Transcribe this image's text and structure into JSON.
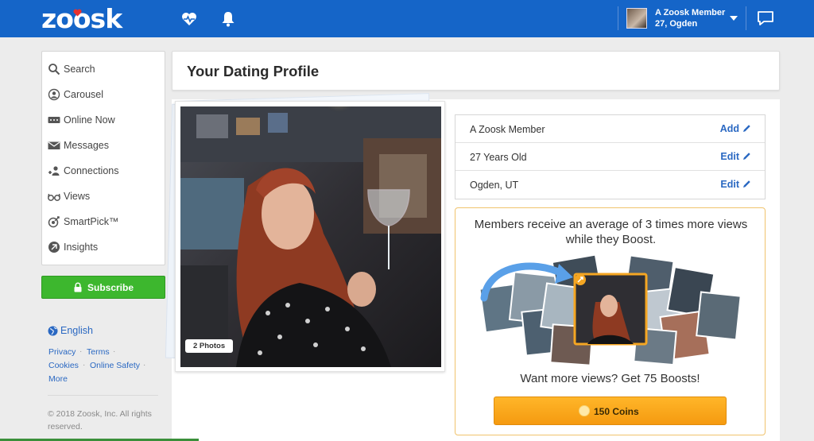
{
  "topbar": {
    "logo_text": "zoosk",
    "member_name": "A Zoosk Member",
    "member_location": "27, Ogden",
    "icons": [
      "heart-pulse-icon",
      "bell-icon",
      "chevron-down-icon",
      "chat-icon"
    ]
  },
  "sidebar": {
    "items": [
      {
        "label": "Search",
        "icon": "search-icon"
      },
      {
        "label": "Carousel",
        "icon": "carousel-icon"
      },
      {
        "label": "Online Now",
        "icon": "online-now-icon"
      },
      {
        "label": "Messages",
        "icon": "envelope-icon"
      },
      {
        "label": "Connections",
        "icon": "connections-icon"
      },
      {
        "label": "Views",
        "icon": "glasses-icon"
      },
      {
        "label": "SmartPick™",
        "icon": "smartpick-icon"
      },
      {
        "label": "Insights",
        "icon": "insights-icon"
      }
    ],
    "subscribe_label": "Subscribe",
    "language": "English",
    "footer_links": [
      "Privacy",
      "Terms",
      "Cookies",
      "Online Safety",
      "More"
    ],
    "copyright": "© 2018 Zoosk, Inc. All rights reserved."
  },
  "main": {
    "title": "Your Dating Profile",
    "photo_badge": "2 Photos",
    "info_rows": [
      {
        "value": "A Zoosk Member",
        "action": "Add"
      },
      {
        "value": "27 Years Old",
        "action": "Edit"
      },
      {
        "value": "Ogden, UT",
        "action": "Edit"
      }
    ],
    "boost": {
      "headline": "Members receive an average of 3 times more views while they Boost.",
      "subline": "Want more views? Get 75 Boosts!",
      "button_label": "150 Coins"
    }
  },
  "colors": {
    "brand_blue": "#1565c8",
    "subscribe_green": "#3db72e",
    "link_blue": "#2a68c2",
    "coins_orange": "#f7a21b"
  }
}
